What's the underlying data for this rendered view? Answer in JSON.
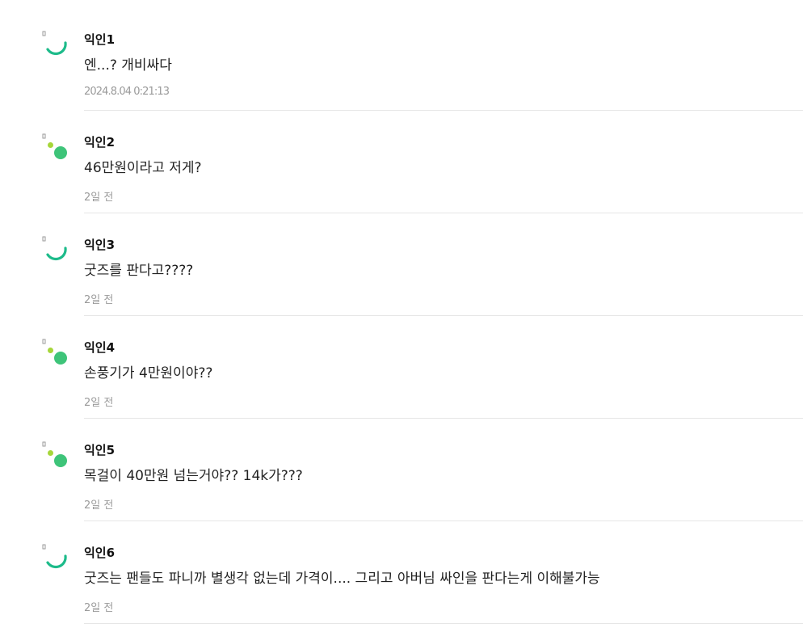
{
  "comments": [
    {
      "author": "익인1",
      "text": "엔...? 개비싸다",
      "time": "2024.8.04 0:21:13",
      "avatar": "arc-icon"
    },
    {
      "author": "익인2",
      "text": "46만원이라고 저게?",
      "time": "2일 전",
      "avatar": "dots-icon"
    },
    {
      "author": "익인3",
      "text": "굿즈를 판다고????",
      "time": "2일 전",
      "avatar": "arc-icon"
    },
    {
      "author": "익인4",
      "text": "손풍기가 4만원이야??",
      "time": "2일 전",
      "avatar": "dots-icon"
    },
    {
      "author": "익인5",
      "text": "목걸이 40만원 넘는거야?? 14k가???",
      "time": "2일 전",
      "avatar": "dots-icon"
    },
    {
      "author": "익인6",
      "text": "굿즈는 팬들도 파니까 별생각 없는데 가격이.... 그리고 아버님 싸인을 판다는게 이해불가능",
      "time": "2일 전",
      "avatar": "arc-icon"
    }
  ],
  "colors": {
    "arc": "#1dbb8a",
    "dot_large": "#3ec479",
    "dot_small": "#a6d63a"
  }
}
